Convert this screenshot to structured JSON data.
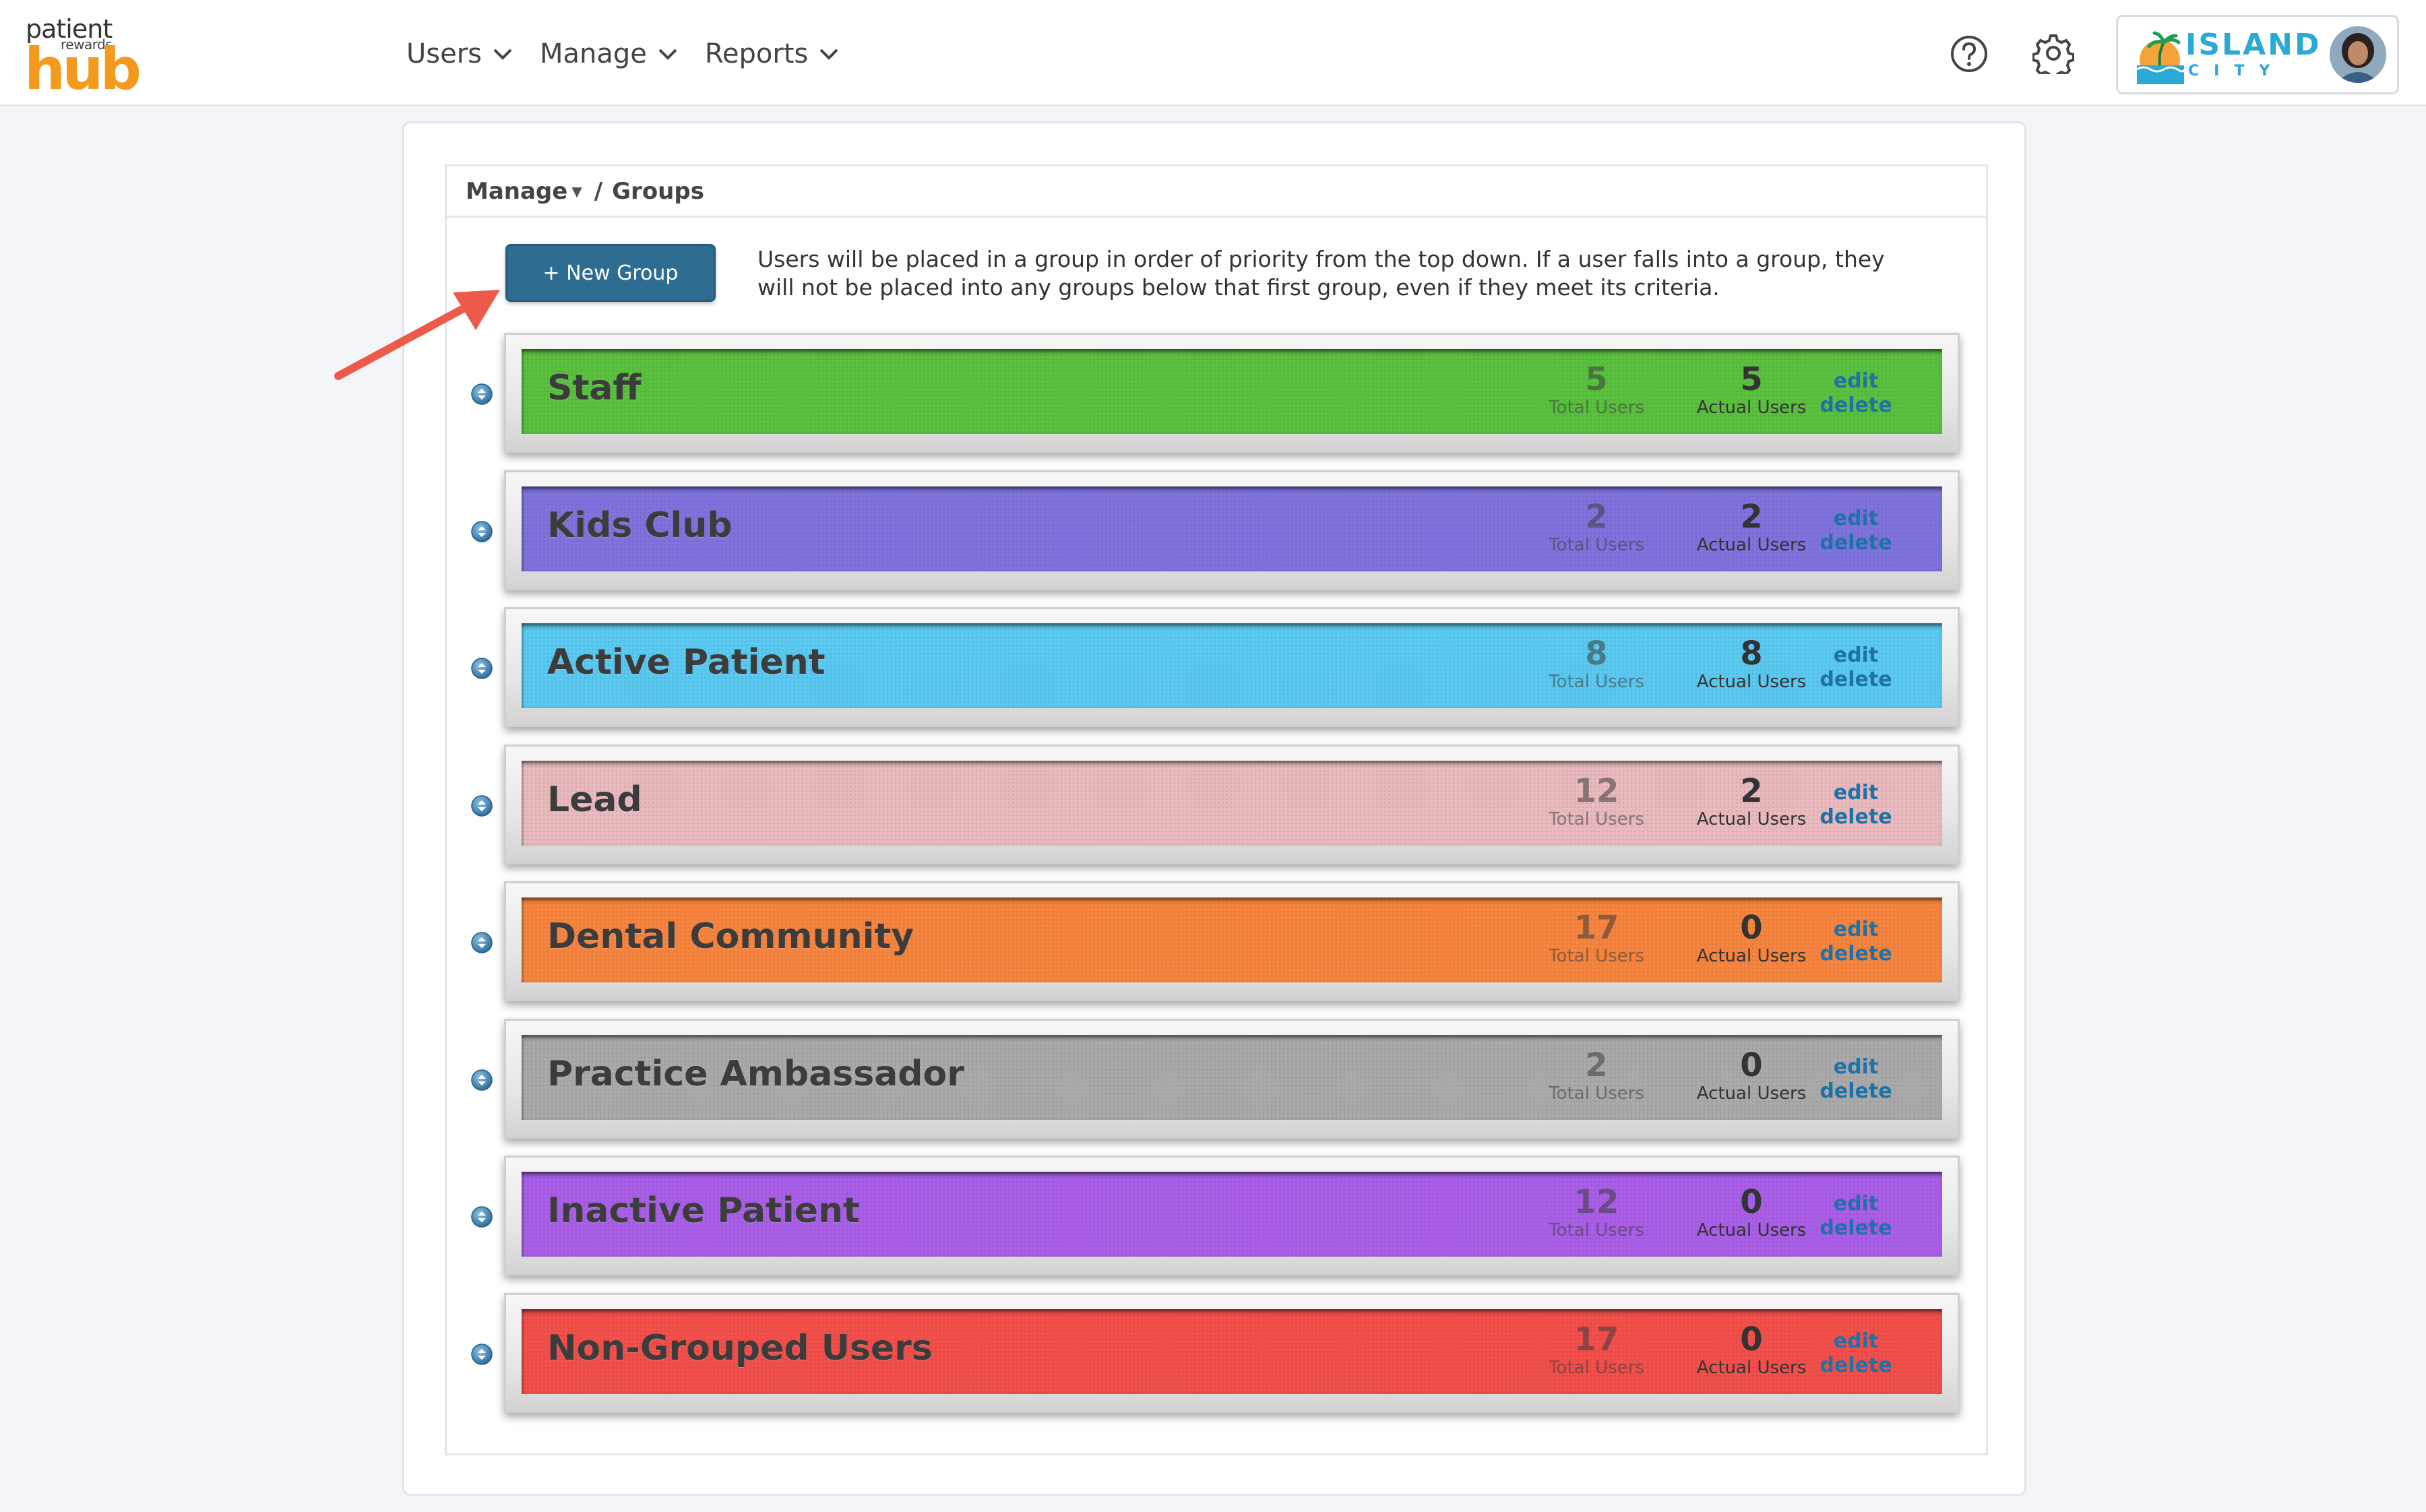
{
  "header": {
    "logo": {
      "line1": "patient",
      "line2": "rewards",
      "line3": "hub"
    },
    "nav": [
      {
        "label": "Users"
      },
      {
        "label": "Manage"
      },
      {
        "label": "Reports"
      }
    ],
    "icons": {
      "help": "help-circle-icon",
      "settings": "gear-icon"
    },
    "account": {
      "brand_line1": "ISLAND",
      "brand_line2": "CITY"
    }
  },
  "breadcrumb": {
    "parent": "Manage",
    "separator": "/",
    "current": "Groups"
  },
  "toolbar": {
    "new_group_label": "+ New Group",
    "intro": "Users will be placed in a group in order of priority from the top down. If a user falls into a group, they will not be placed into any groups below that first group, even if they meet its criteria."
  },
  "labels": {
    "total_users": "Total Users",
    "actual_users": "Actual Users",
    "edit": "edit",
    "delete": "delete"
  },
  "groups": [
    {
      "name": "Staff",
      "total": "5",
      "actual": "5",
      "color": "#5abf3f"
    },
    {
      "name": "Kids Club",
      "total": "2",
      "actual": "2",
      "color": "#7e73dc"
    },
    {
      "name": "Active Patient",
      "total": "8",
      "actual": "8",
      "color": "#5ac8ef"
    },
    {
      "name": "Lead",
      "total": "12",
      "actual": "2",
      "color": "#e8b9bd"
    },
    {
      "name": "Dental Community",
      "total": "17",
      "actual": "0",
      "color": "#f5843f"
    },
    {
      "name": "Practice Ambassador",
      "total": "2",
      "actual": "0",
      "color": "#a9a9a9"
    },
    {
      "name": "Inactive Patient",
      "total": "12",
      "actual": "0",
      "color": "#a85ee6"
    },
    {
      "name": "Non-Grouped Users",
      "total": "17",
      "actual": "0",
      "color": "#f14f4a"
    }
  ]
}
